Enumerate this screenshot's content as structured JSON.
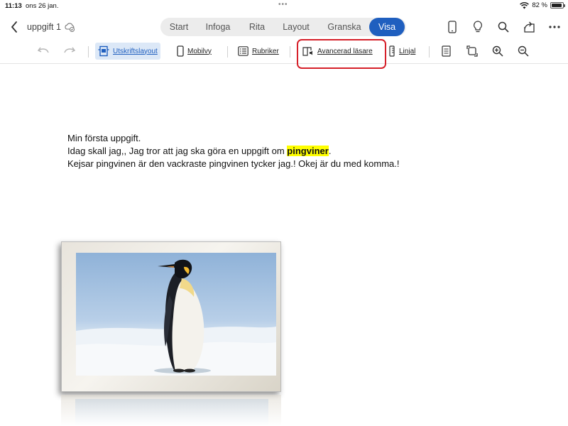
{
  "status_bar": {
    "time": "11:13",
    "date": "ons 26 jan.",
    "battery": "82 %"
  },
  "header": {
    "doc_title": "uppgift 1",
    "tabs": [
      {
        "label": "Start"
      },
      {
        "label": "Infoga"
      },
      {
        "label": "Rita"
      },
      {
        "label": "Layout"
      },
      {
        "label": "Granska"
      },
      {
        "label": "Visa"
      }
    ],
    "active_tab": "Visa",
    "accent_color": "#1f5fbf"
  },
  "ribbon": {
    "print_layout": "Utskriftslayout",
    "mobile_view": "Mobilvy",
    "headings": "Rubriker",
    "immersive_reader": "Avancerad läsare",
    "ruler": "Linjal"
  },
  "document": {
    "line1": "Min första uppgift.",
    "line2_before": "Idag skall jag,, Jag tror att jag ska göra en uppgift om ",
    "line2_highlight": "pingviner",
    "line2_after": ".",
    "line3": "Kejsar pingvinen är den vackraste pingvinen tycker jag.! Okej är du med komma.!",
    "highlight_color": "#ffff00"
  },
  "annotation": {
    "box_color": "#d6202a"
  }
}
